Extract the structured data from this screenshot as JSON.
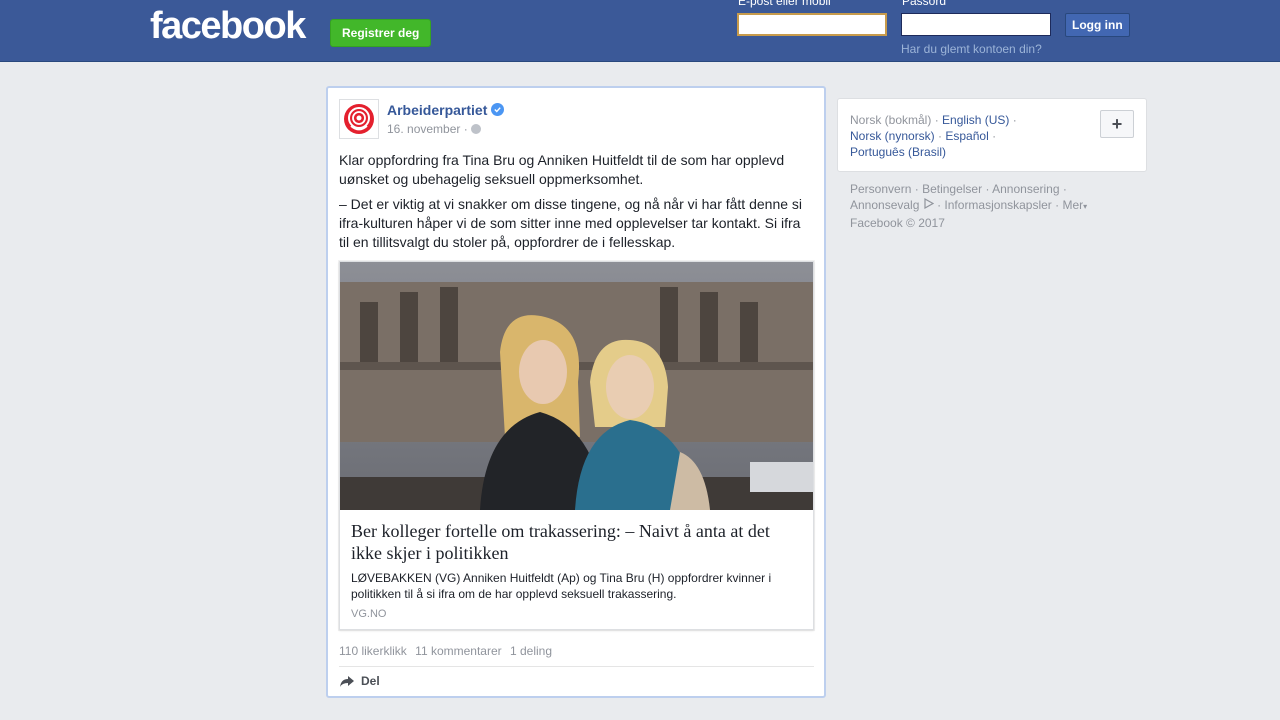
{
  "header": {
    "logo": "facebook",
    "register_label": "Registrer deg",
    "email_label": "E-post eller mobil",
    "password_label": "Passord",
    "login_label": "Logg inn",
    "forgot_label": "Har du glemt kontoen din?"
  },
  "post": {
    "page_name": "Arbeiderpartiet",
    "date": "16. november",
    "paragraphs": [
      "Klar oppfordring fra Tina Bru og Anniken Huitfeldt til de som har opplevd uønsket og ubehagelig seksuell oppmerksomhet.",
      "– Det er viktig at vi snakker om disse tingene, og nå når vi har fått denne si ifra-kulturen håper vi de som sitter inne med opplevelser tar kontakt. Si ifra til en tillitsvalgt du stoler på, oppfordrer de i fellesskap."
    ],
    "link": {
      "title": "Ber kolleger fortelle om trakassering: – Naivt å anta at det ikke skjer i politikken",
      "description": "LØVEBAKKEN (VG) Anniken Huitfeldt (Ap) og Tina Bru (H) oppfordrer kvinner i politikken til å si ifra om de har opplevd seksuell trakassering.",
      "domain": "VG.NO"
    },
    "stats": {
      "likes": "110 likerklikk",
      "comments": "11 kommentarer",
      "shares": "1 deling"
    },
    "share_label": "Del"
  },
  "languages": {
    "current": "Norsk (bokmål)",
    "items": [
      "English (US)",
      "Norsk (nynorsk)",
      "Español",
      "Português (Brasil)"
    ],
    "add_label": "+"
  },
  "footer": {
    "links": [
      "Personvern",
      "Betingelser",
      "Annonsering",
      "Annonsevalg",
      "Informasjonskapsler",
      "Mer"
    ],
    "copyright": "Facebook © 2017"
  },
  "colors": {
    "brand_blue": "#3b5998",
    "register_green": "#42b72a",
    "link_blue": "#365899"
  }
}
